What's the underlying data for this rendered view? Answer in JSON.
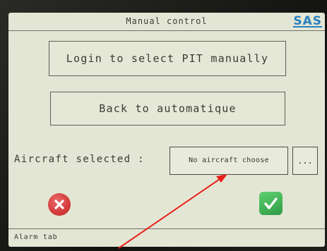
{
  "window": {
    "title": "Manual control",
    "logo_text": "SAS"
  },
  "buttons": {
    "login_label": "Login to select PIT manually",
    "back_label": "Back to automatique",
    "more_label": "..."
  },
  "aircraft": {
    "label": "Aircraft selected :",
    "value": "No aircraft choose"
  },
  "actions": {
    "cancel_icon": "close-icon",
    "confirm_icon": "checkmark-icon",
    "cancel_color": "#d33b3b",
    "confirm_color": "#3aa84d"
  },
  "footer": {
    "alarm_tab_label": "Alarm tab"
  },
  "annotation": {
    "arrow_color": "#e8221a"
  }
}
